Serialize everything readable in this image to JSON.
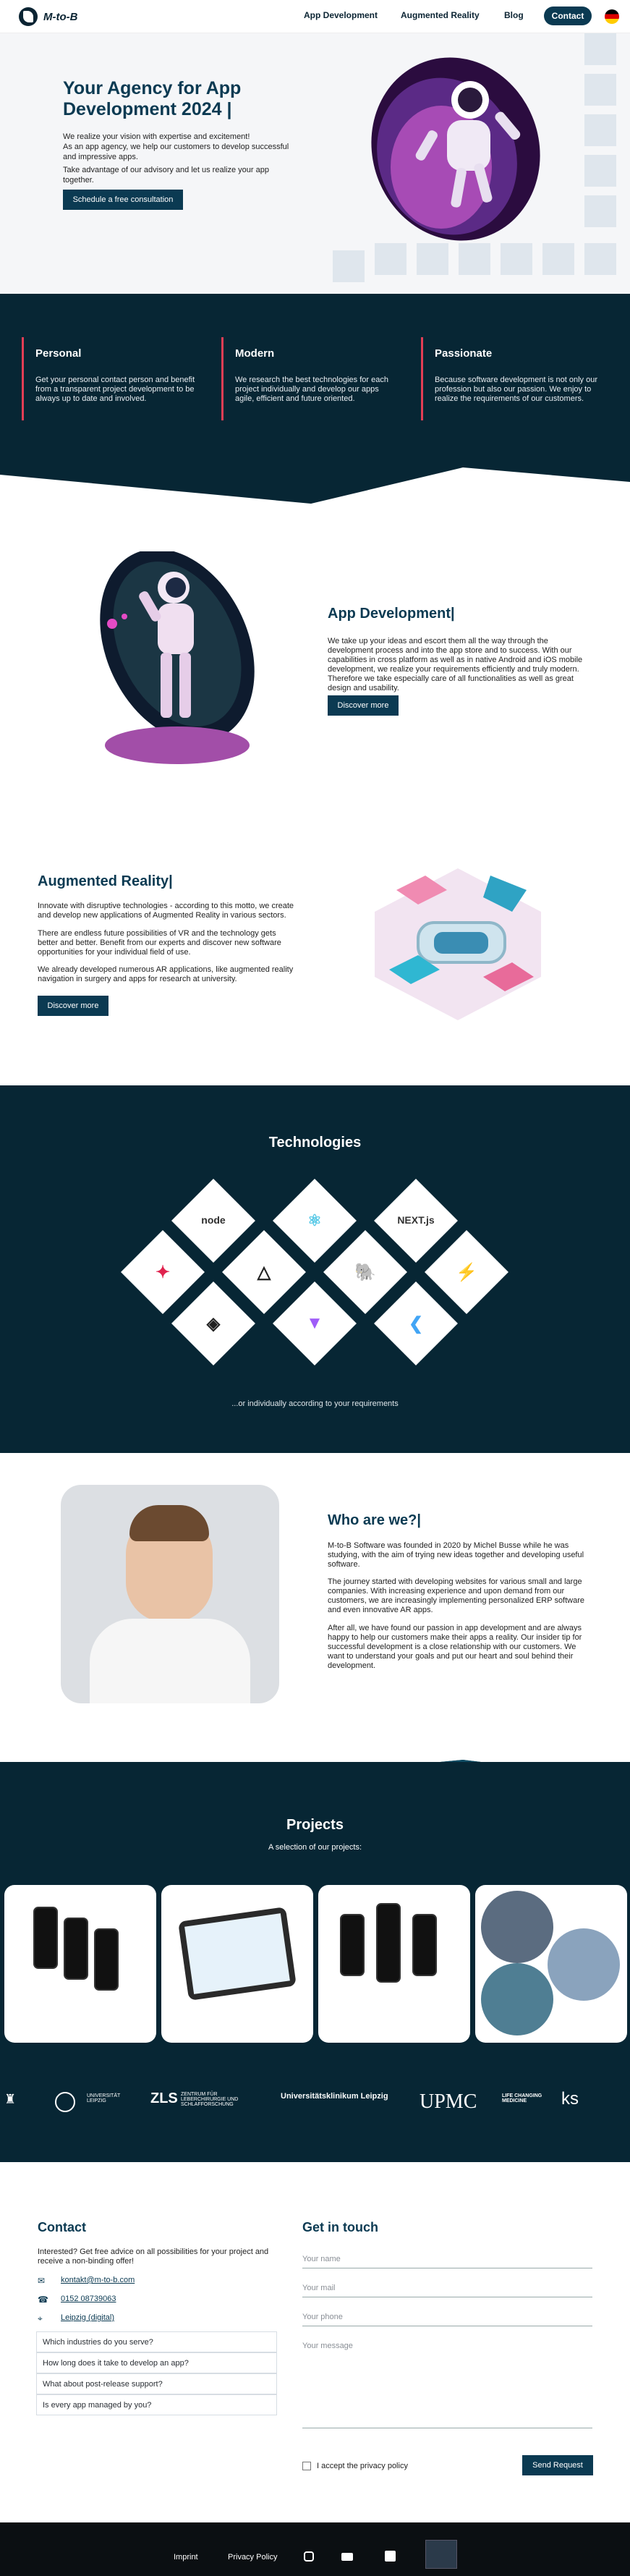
{
  "header": {
    "logo": "M-to-B",
    "nav": [
      "App Development",
      "Augmented Reality",
      "Blog"
    ],
    "contact": "Contact"
  },
  "hero": {
    "title": "Your Agency for App Development 2024 |",
    "p1": "We realize your vision with expertise and excitement!",
    "p2": "As an app agency, we help our customers to develop successful and impressive apps.",
    "p3": "Take advantage of our advisory and let us realize your app together.",
    "cta": "Schedule a free consultation"
  },
  "features": [
    {
      "title": "Personal",
      "text": "Get your personal contact person and benefit from a transparent project development to be always up to date and involved."
    },
    {
      "title": "Modern",
      "text": "We research the best technologies for each project individually and develop our apps agile, efficient and future oriented."
    },
    {
      "title": "Passionate",
      "text": "Because software development is not only our profession but also our passion. We enjoy to realize the requirements of our customers."
    }
  ],
  "appdev": {
    "title": "App Development|",
    "text": "We take up your ideas and escort them all the way through the development process and into the app store and to success. With our capabilities in cross platform as well as in native Android and iOS mobile development, we realize your requirements efficiently and truly modern. Therefore we take especially care of all functionalities as well as great design and usability.",
    "cta": "Discover more"
  },
  "ar": {
    "title": "Augmented Reality|",
    "p1": "Innovate with disruptive technologies - according to this motto, we create and develop new applications of Augmented Reality in various sectors.",
    "p2": "There are endless future possibilities of VR and the technology gets better and better. Benefit from our experts and discover new software opportunities for your individual field of use.",
    "p3": "We already developed numerous AR applications, like augmented reality navigation in surgery and apps for research at university.",
    "cta": "Discover more"
  },
  "tech": {
    "title": "Technologies",
    "caption": "...or individually according to your requirements",
    "items": [
      "node",
      "react",
      "NEXT.js",
      "nest",
      "three",
      "postgres",
      "supabase",
      "unity",
      "vite",
      "flutter"
    ]
  },
  "about": {
    "title": "Who are we?|",
    "p1": "M-to-B Software was founded in 2020 by Michel Busse while he was studying, with the aim of trying new ideas together and developing useful software.",
    "p2": "The journey started with developing websites for various small and large companies. With increasing experience and upon demand from our customers, we are increasingly implementing personalized ERP software and even innovative AR apps.",
    "p3": "After all, we have found our passion in app development and are always happy to help our customers make their apps a reality. Our insider tip for successful development is a close relationship with our customers. We want to understand your goals and put our heart and soul behind their development."
  },
  "projects": {
    "title": "Projects",
    "subtitle": "A selection of our projects:"
  },
  "partners": [
    "UNIVERSITÄT LEIPZIG",
    "ZENTRUM FÜR LEBERCHIRURGIE UND SCHLAFFORSCHUNG",
    "Universitätsklinikum Leipzig",
    "UPMC",
    "LIFE CHANGING MEDICINE",
    "ks"
  ],
  "contact": {
    "title": "Contact",
    "intro": "Interested? Get free advice on all possibilities for your project and receive a non-binding offer!",
    "email": "kontakt@m-to-b.com",
    "phone": "0152 08739063",
    "address": "Leipzig (digital)",
    "faqs": [
      "Which industries do you serve?",
      "How long does it take to develop an app?",
      "What about post-release support?",
      "Is every app managed by you?"
    ]
  },
  "form": {
    "title": "Get in touch",
    "name": "Your name",
    "mail": "Your mail",
    "phone": "Your phone",
    "message": "Your message",
    "privacy": "I accept the privacy policy",
    "submit": "Send Request"
  },
  "footer": {
    "imprint": "Imprint",
    "privacy": "Privacy Policy"
  },
  "colors": {
    "navy": "#072634",
    "accent": "#e33e55",
    "button": "#0b3a52"
  }
}
